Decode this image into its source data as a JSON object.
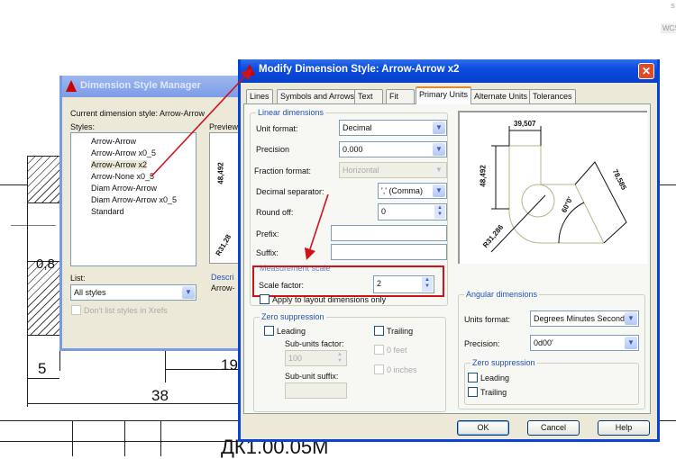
{
  "background": {
    "dim_0_8": "0,8",
    "dim_5": "5",
    "dim_19": "19",
    "dim_38": "38",
    "drawing_code": "ДК1.00.05М",
    "corner_label": "WCS",
    "corner_s": "S"
  },
  "manager": {
    "title": "Dimension Style Manager",
    "current_style": "Current dimension style: Arrow-Arrow",
    "styles_label": "Styles:",
    "styles": [
      "Arrow-Arrow",
      "Arrow-Arrow x0_5",
      "Arrow-Arrow x2",
      "Arrow-None x0_5",
      "Diam Arrow-Arrow",
      "Diam Arrow-Arrow x0_5",
      "Standard"
    ],
    "selected_style": "Arrow-Arrow x2",
    "list_label": "List:",
    "list_value": "All styles",
    "xrefs_checkbox": "Don't list styles in Xrefs",
    "preview_label": "Preview",
    "description_label": "Descri",
    "description_value": "Arrow-",
    "preview_dim_1": "48,492",
    "preview_dim_2": "R31,28"
  },
  "modify": {
    "title": "Modify Dimension Style: Arrow-Arrow x2",
    "tabs": [
      "Lines",
      "Symbols and Arrows",
      "Text",
      "Fit",
      "Primary Units",
      "Alternate Units",
      "Tolerances"
    ],
    "active_tab": "Primary Units",
    "linear": {
      "group": "Linear dimensions",
      "unit_format_label": "Unit format:",
      "unit_format": "Decimal",
      "precision_label": "Precision",
      "precision": "0.000",
      "fraction_label": "Fraction format:",
      "fraction": "Horizontal",
      "decimal_sep_label": "Decimal separator:",
      "decimal_sep": "',' (Comma)",
      "round_off_label": "Round off:",
      "round_off": "0",
      "prefix_label": "Prefix:",
      "prefix": "",
      "suffix_label": "Suffix:",
      "suffix": ""
    },
    "measurement": {
      "group": "Measurement scale",
      "scale_label": "Scale factor:",
      "scale": "2",
      "apply_layout": "Apply to layout dimensions only"
    },
    "zero": {
      "group": "Zero suppression",
      "leading": "Leading",
      "trailing": "Trailing",
      "subunits_label": "Sub-units factor:",
      "subunits": "100",
      "subunit_suffix_label": "Sub-unit suffix:",
      "subunit_suffix": "",
      "feet": "0 feet",
      "inches": "0 inches"
    },
    "preview": {
      "d1": "39,507",
      "d2": "48,492",
      "d3": "78,585",
      "d4": "60°0'",
      "d5": "R31,286"
    },
    "angular": {
      "group": "Angular dimensions",
      "units_label": "Units format:",
      "units": "Degrees Minutes Seconds",
      "precision_label": "Precision:",
      "precision": "0d00'",
      "zero_group": "Zero suppression",
      "leading": "Leading",
      "trailing": "Trailing"
    },
    "buttons": {
      "ok": "OK",
      "cancel": "Cancel",
      "help": "Help"
    }
  },
  "colors": {
    "annotation": "#d0121b",
    "title_active": "#0a4be0"
  }
}
